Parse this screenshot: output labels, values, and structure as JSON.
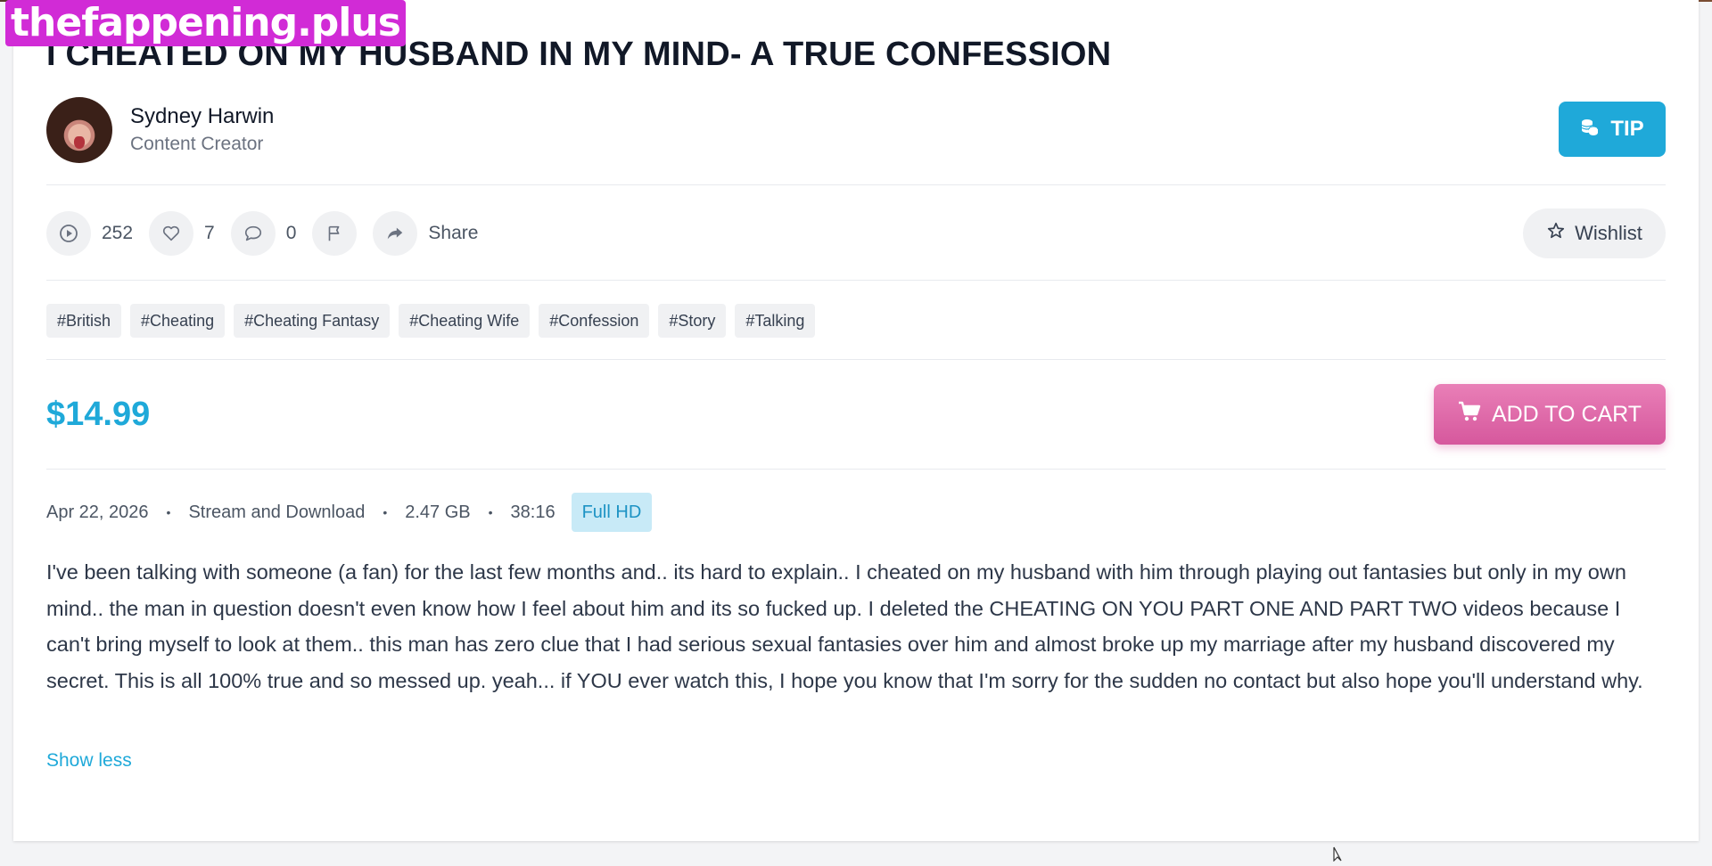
{
  "watermark": "thefappening.plus",
  "title": "I CHEATED ON MY HUSBAND IN MY MIND- A TRUE CONFESSION",
  "creator": {
    "name": "Sydney Harwin",
    "role": "Content Creator"
  },
  "tip_label": "TIP",
  "stats": {
    "views": "252",
    "likes": "7",
    "comments": "0",
    "share_label": "Share"
  },
  "wishlist_label": "Wishlist",
  "tags": [
    "#British",
    "#Cheating",
    "#Cheating Fantasy",
    "#Cheating Wife",
    "#Confession",
    "#Story",
    "#Talking"
  ],
  "price": "$14.99",
  "cart_label": "ADD TO CART",
  "meta": {
    "date": "Apr 22, 2026",
    "access": "Stream and Download",
    "size": "2.47 GB",
    "duration": "38:16",
    "quality": "Full HD",
    "separator": "•"
  },
  "description": "I've been talking with someone (a fan) for the last few months and.. its hard to explain.. I cheated on my husband with him through playing out fantasies but only in my own mind.. the man in question doesn't even know how I feel about him and its so fucked up. I deleted the CHEATING ON YOU PART ONE AND PART TWO videos because I can't bring myself to look at them.. this man has zero clue that I had serious sexual fantasies over him and almost broke up my marriage after my husband discovered my secret. This is all 100% true and so messed up. yeah... if YOU ever watch this, I hope you know that I'm sorry for the sudden no contact but also hope you'll understand why.",
  "show_less_label": "Show less",
  "colors": {
    "accent": "#1fa9d9",
    "cart": "#d6589d",
    "watermark": "#d12bd6"
  }
}
